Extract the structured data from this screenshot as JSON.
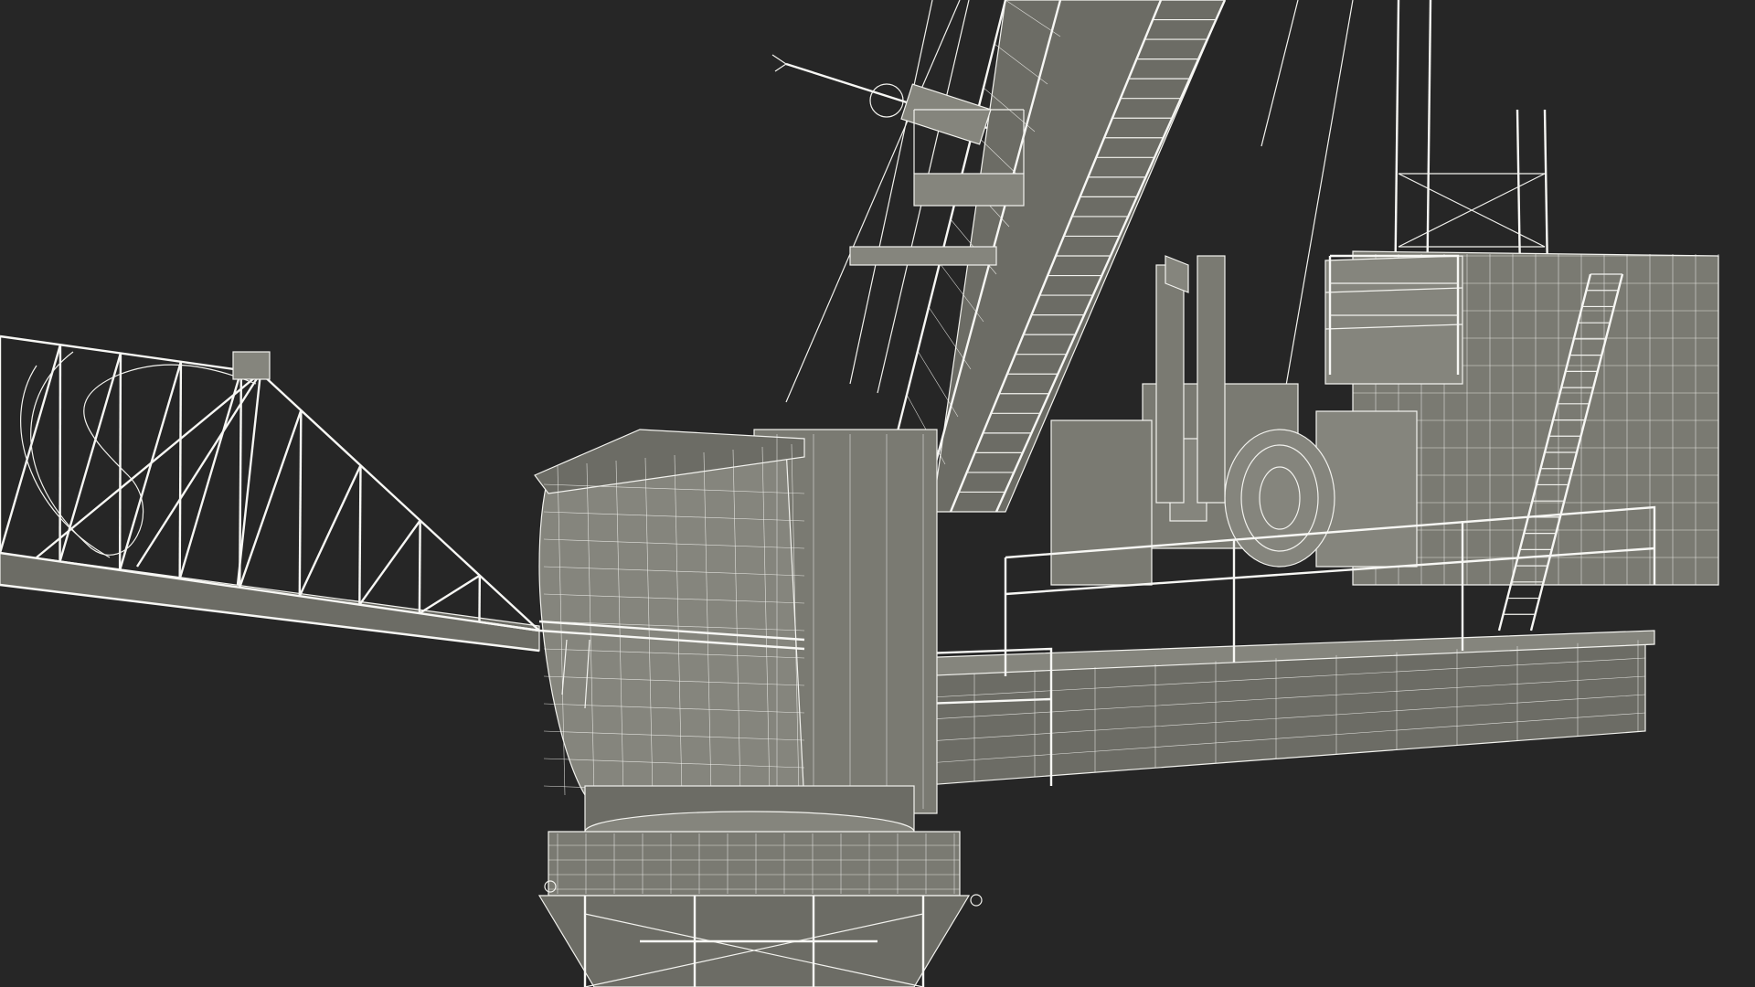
{
  "colors": {
    "background": "#262626",
    "wire": "#f2f2ee",
    "surface": "#7a7a72",
    "surface_dark": "#6c6c65",
    "surface_light": "#85857d"
  }
}
